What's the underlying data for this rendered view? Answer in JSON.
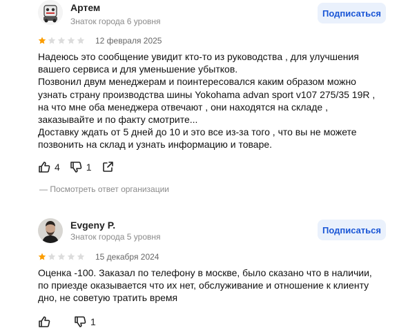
{
  "reviews": [
    {
      "author": "Артем",
      "level": "Знаток города 6 уровня",
      "subscribe_label": "Подписаться",
      "rating": 1,
      "rating_max": 5,
      "date": "12 февраля 2025",
      "text": "Надеюсь это сообщение увидит кто-то из руководства , для улучшения\nвашего сервиса и для уменьшение убытков.\nПозвонил двум менеджерам и поинтересовался каким образом можно\nузнать страну производства шины Yokohama advan sport v107 275/35 19R ,\nна что мне оба менеджера отвечают , они находятся на складе ,\nзаказывайте и по факту смотрите...\nДоставку ждать от 5 дней до 10 и это все из-за того , что вы не можете\nпозвонить на склад и узнать информацию и товаре.",
      "likes": "4",
      "dislikes": "1",
      "org_answer_label": "— Посмотреть ответ организации"
    },
    {
      "author": "Evgeny P.",
      "level": "Знаток города 5 уровня",
      "subscribe_label": "Подписаться",
      "rating": 1,
      "rating_max": 5,
      "date": "15 декабря 2024",
      "text": "Оценка -100. Заказал по телефону в москве, было сказано что в наличии,\nпо приезде оказывается что их нет, обслуживание и отношение к клиенту\nдно, не советую тратить время",
      "likes": "",
      "dislikes": "1"
    }
  ],
  "colors": {
    "star_filled": "#fc9d00",
    "star_empty": "#dcdcdc",
    "subscribe_bg": "#eaf1fc",
    "subscribe_text": "#1a56d6"
  }
}
